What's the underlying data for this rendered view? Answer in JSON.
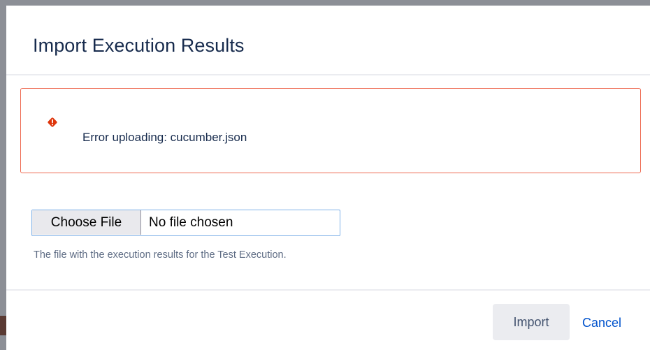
{
  "dialog": {
    "title": "Import Execution Results"
  },
  "error": {
    "icon": "error-diamond-icon",
    "color": "#de350b",
    "border_color": "#ee6a51",
    "message": "Error uploading: cucumber.json"
  },
  "file_input": {
    "button_label": "Choose File",
    "status": "No file chosen",
    "description": "The file with the execution results for the Test Execution."
  },
  "footer": {
    "import_label": "Import",
    "cancel_label": "Cancel"
  },
  "colors": {
    "title": "#172b4d",
    "link": "#0052cc",
    "focus_ring": "#7fb1e8"
  }
}
